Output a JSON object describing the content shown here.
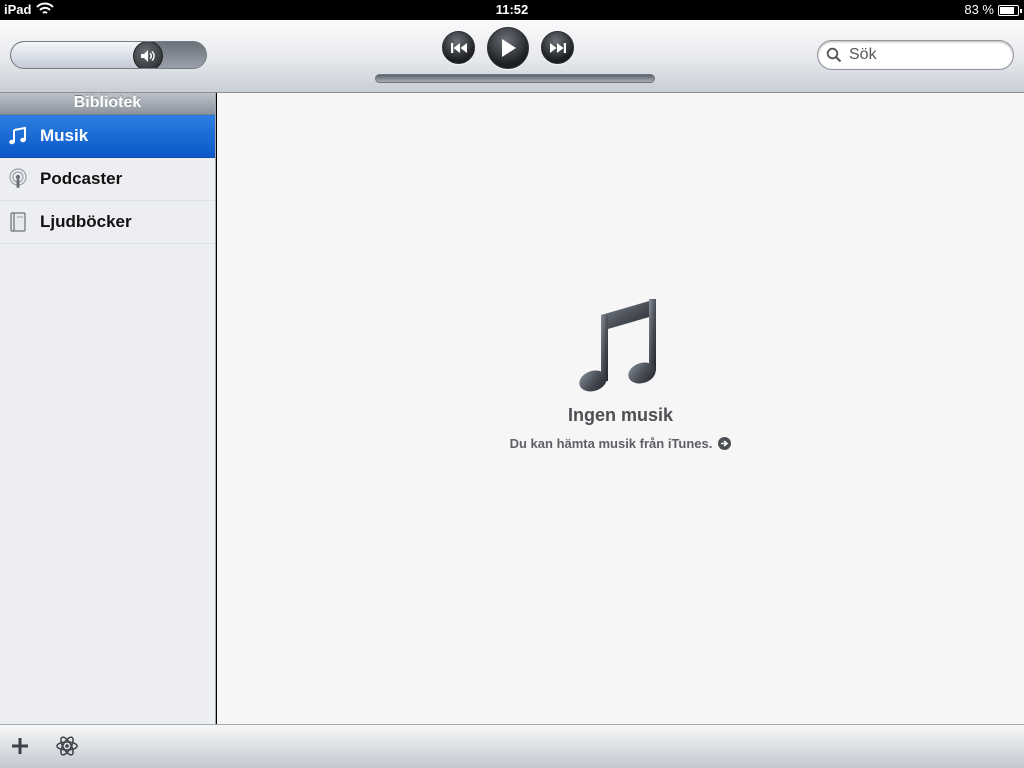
{
  "status_bar": {
    "device": "iPad",
    "time": "11:52",
    "battery": "83 %",
    "battery_level": 0.83
  },
  "toolbar": {
    "volume_level": 0.7,
    "search_placeholder": "Sök"
  },
  "sidebar": {
    "header": "Bibliotek",
    "items": [
      {
        "label": "Musik",
        "icon": "music-note-icon",
        "selected": true
      },
      {
        "label": "Podcaster",
        "icon": "podcast-icon",
        "selected": false
      },
      {
        "label": "Ljudböcker",
        "icon": "audiobook-icon",
        "selected": false
      }
    ]
  },
  "main": {
    "empty_title": "Ingen musik",
    "empty_subtitle": "Du kan hämta musik från iTunes."
  },
  "colors": {
    "selection": "#0b57c8",
    "sidebar_header": "#8d949d",
    "content_bg": "#f6f6f6"
  }
}
